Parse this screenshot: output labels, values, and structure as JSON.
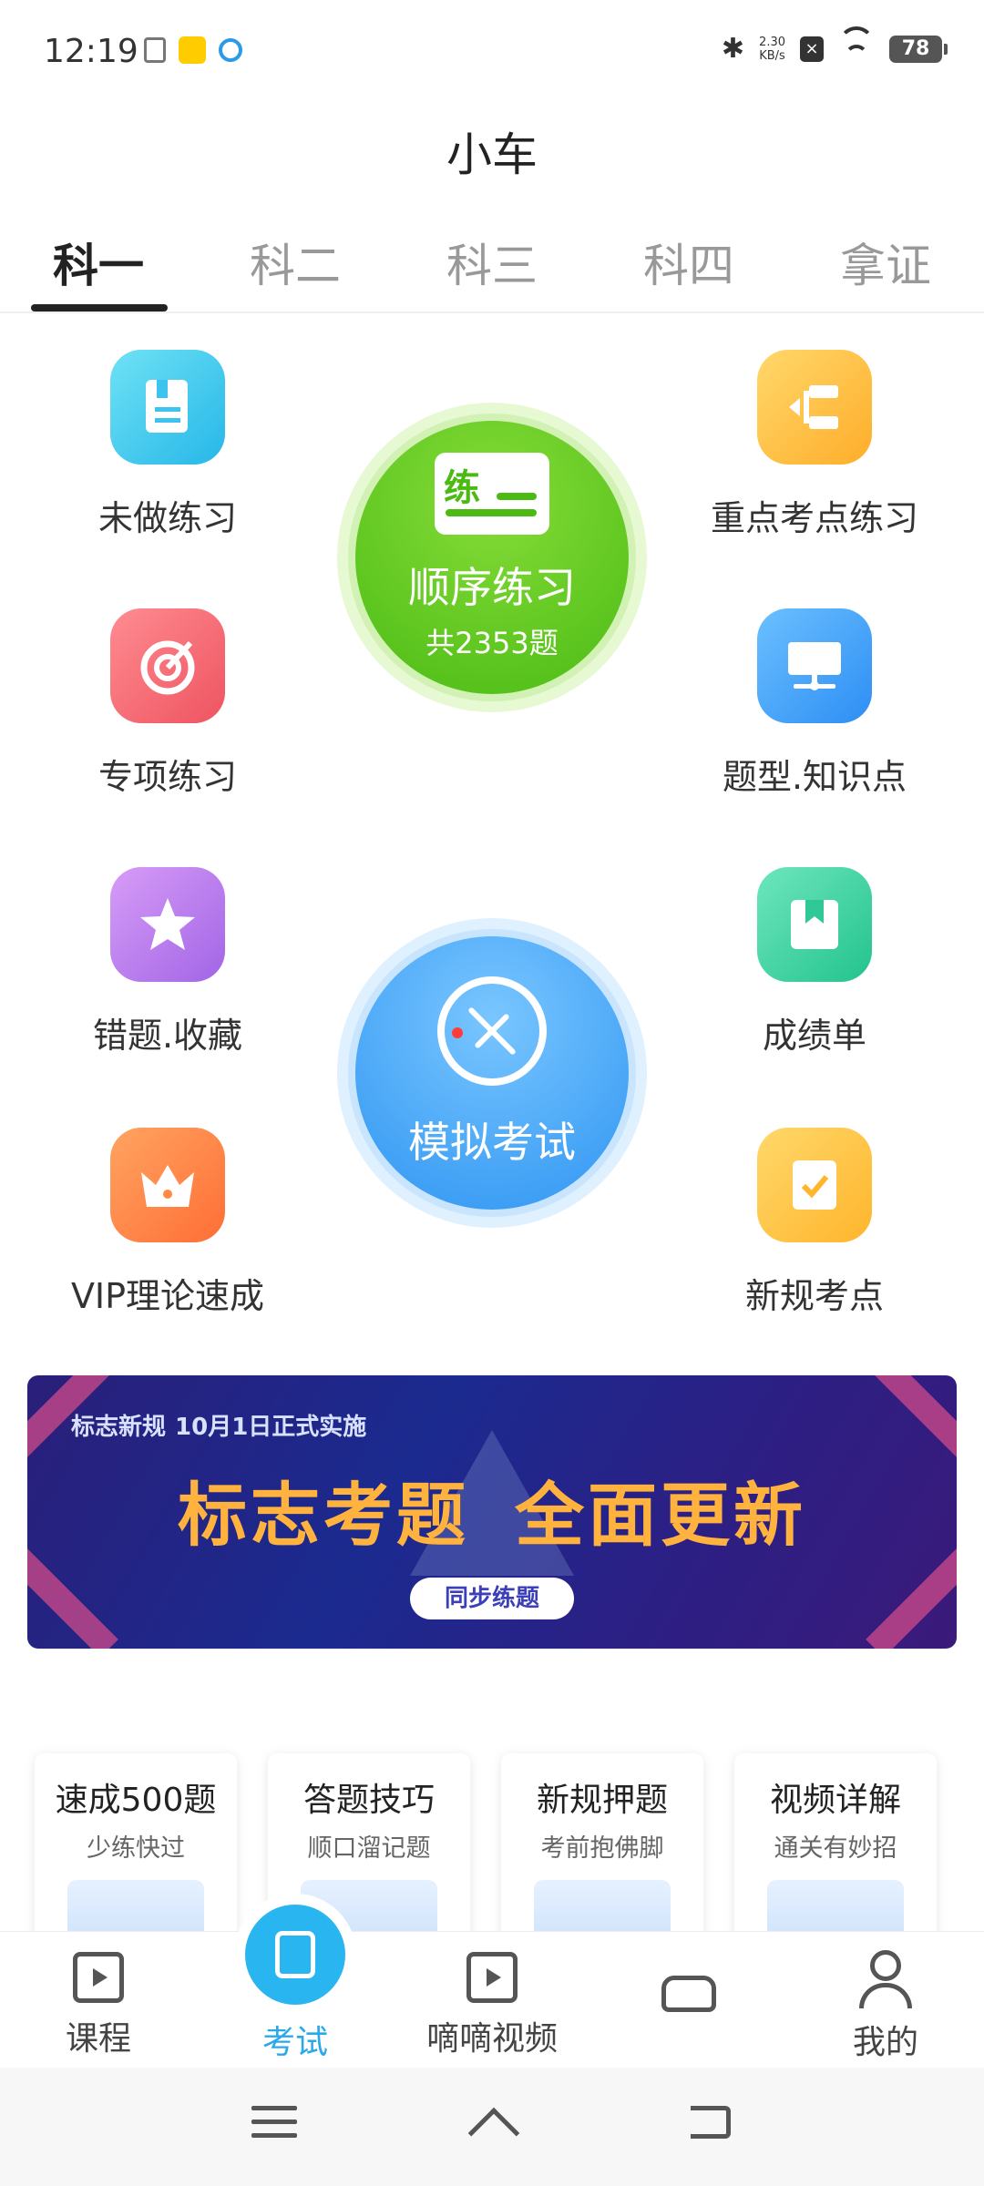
{
  "status_bar": {
    "time": "12:19",
    "net_speed_top": "2.30",
    "net_speed_bottom": "KB/s",
    "battery": "78"
  },
  "page_title": "小车",
  "tabs": [
    {
      "label": "科一",
      "active": true
    },
    {
      "label": "科二",
      "active": false
    },
    {
      "label": "科三",
      "active": false
    },
    {
      "label": "科四",
      "active": false
    },
    {
      "label": "拿证",
      "active": false
    }
  ],
  "features": {
    "undone": {
      "label": "未做练习",
      "icon": "book-icon"
    },
    "key_points": {
      "label": "重点考点练习",
      "icon": "flowchart-icon"
    },
    "special": {
      "label": "专项练习",
      "icon": "target-icon"
    },
    "knowledge": {
      "label": "题型.知识点",
      "icon": "monitor-icon"
    },
    "wrong_fav": {
      "label": "错题.收藏",
      "icon": "star-icon"
    },
    "score": {
      "label": "成绩单",
      "icon": "bookmark-icon"
    },
    "vip": {
      "label": "VIP理论速成",
      "icon": "crown-icon"
    },
    "new_rules": {
      "label": "新规考点",
      "icon": "checklist-icon"
    }
  },
  "sequential": {
    "icon_char": "练",
    "title": "顺序练习",
    "subtitle": "共2353题"
  },
  "mock_exam": {
    "title": "模拟考试"
  },
  "banner": {
    "tag_part1": "标志新规",
    "tag_part2": "10月1日正式实施",
    "headline_part1": "标志考题",
    "headline_part2": "全面更新",
    "button": "同步练题"
  },
  "cards": [
    {
      "title": "速成500题",
      "subtitle": "少练快过"
    },
    {
      "title": "答题技巧",
      "subtitle": "顺口溜记题"
    },
    {
      "title": "新规押题",
      "subtitle": "考前抱佛脚"
    },
    {
      "title": "视频详解",
      "subtitle": "通关有妙招"
    }
  ],
  "bottom_nav": [
    {
      "label": "课程",
      "active": false
    },
    {
      "label": "考试",
      "active": true
    },
    {
      "label": "嘀嘀视频",
      "active": false
    },
    {
      "label": "",
      "active": false
    },
    {
      "label": "我的",
      "active": false
    }
  ],
  "colors": {
    "accent": "#29b6f0",
    "green": "#5cc71f",
    "blue": "#3a9cf4"
  }
}
